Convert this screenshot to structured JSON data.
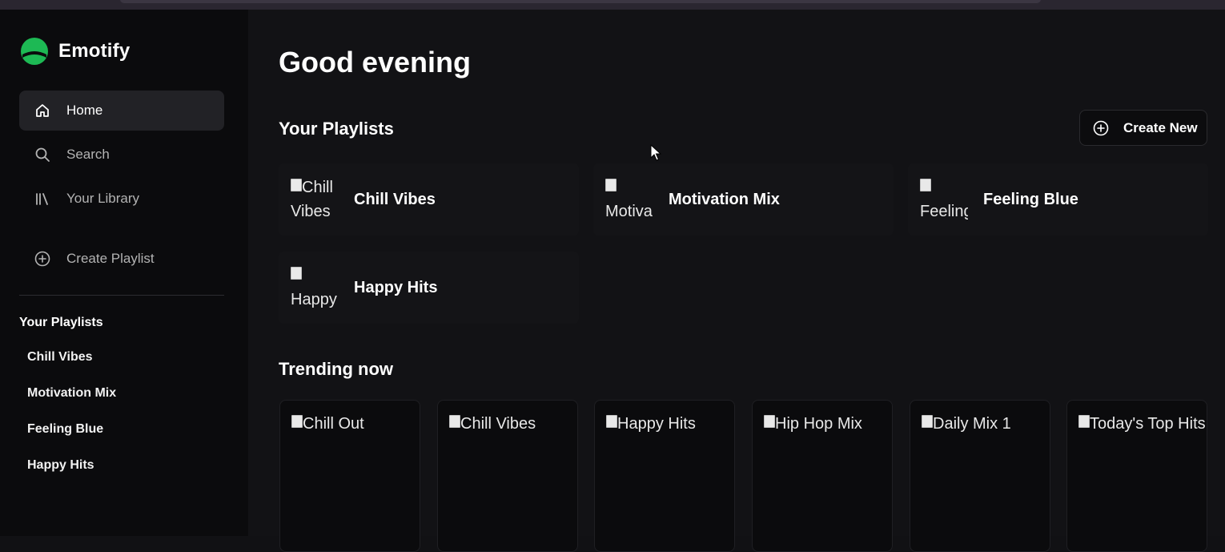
{
  "app": {
    "name": "Emotify",
    "brand_color": "#1db954"
  },
  "sidebar": {
    "nav": [
      {
        "label": "Home",
        "icon": "home-icon",
        "active": true
      },
      {
        "label": "Search",
        "icon": "search-icon",
        "active": false
      },
      {
        "label": "Your Library",
        "icon": "library-icon",
        "active": false
      }
    ],
    "create_playlist": {
      "label": "Create Playlist",
      "icon": "plus-circle-icon"
    },
    "playlists_title": "Your Playlists",
    "playlists": [
      "Chill Vibes",
      "Motivation Mix",
      "Feeling Blue",
      "Happy Hits"
    ]
  },
  "main": {
    "greeting": "Good evening",
    "your_playlists": {
      "title": "Your Playlists",
      "create_new_label": "Create New",
      "items": [
        {
          "name": "Chill Vibes",
          "thumb_alt": "Chill Vibes"
        },
        {
          "name": "Motivation Mix",
          "thumb_alt": "Motiva Mix"
        },
        {
          "name": "Feeling Blue",
          "thumb_alt": "Feeling Bl"
        },
        {
          "name": "Happy Hits",
          "thumb_alt": "Happy Hi"
        }
      ]
    },
    "trending": {
      "title": "Trending now",
      "items": [
        {
          "alt": "Chill Out"
        },
        {
          "alt": "Chill Vibes"
        },
        {
          "alt": "Happy Hits"
        },
        {
          "alt": "Hip Hop Mix"
        },
        {
          "alt": "Daily Mix 1"
        },
        {
          "alt": "Today's Top Hits"
        }
      ]
    }
  }
}
